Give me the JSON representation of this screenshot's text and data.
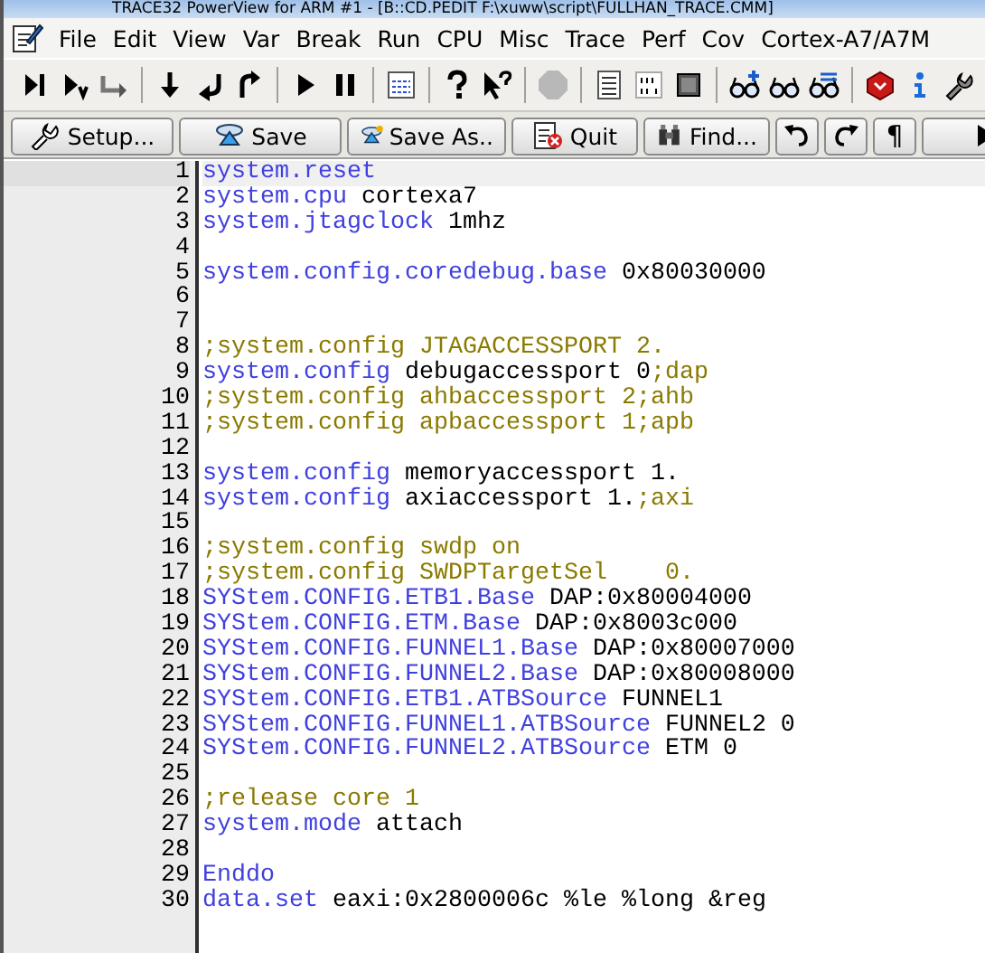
{
  "window": {
    "title": "TRACE32 PowerView for ARM #1 - [B::CD.PEDIT F:\\xuww\\script\\FULLHAN_TRACE.CMM]"
  },
  "menu": [
    "File",
    "Edit",
    "View",
    "Var",
    "Break",
    "Run",
    "CPU",
    "Misc",
    "Trace",
    "Perf",
    "Cov",
    "Cortex-A7/A7M"
  ],
  "toolbar": [
    {
      "kind": "step"
    },
    {
      "kind": "step-over"
    },
    {
      "kind": "step-out"
    },
    {
      "kind": "sep"
    },
    {
      "kind": "down"
    },
    {
      "kind": "return"
    },
    {
      "kind": "redo"
    },
    {
      "kind": "sep"
    },
    {
      "kind": "go"
    },
    {
      "kind": "pause"
    },
    {
      "kind": "sep"
    },
    {
      "kind": "note"
    },
    {
      "kind": "sep"
    },
    {
      "kind": "help"
    },
    {
      "kind": "help-pointer"
    },
    {
      "kind": "sep"
    },
    {
      "kind": "stop",
      "disabled": true
    },
    {
      "kind": "sep"
    },
    {
      "kind": "list"
    },
    {
      "kind": "binary"
    },
    {
      "kind": "chip"
    },
    {
      "kind": "sep"
    },
    {
      "kind": "glasses-plus"
    },
    {
      "kind": "glasses"
    },
    {
      "kind": "glasses-list"
    },
    {
      "kind": "sep"
    },
    {
      "kind": "box"
    },
    {
      "kind": "info"
    },
    {
      "kind": "wrench"
    }
  ],
  "editor_buttons": [
    {
      "kind": "wrench",
      "label": "Setup..."
    },
    {
      "kind": "save",
      "label": "Save"
    },
    {
      "kind": "save-as",
      "label": "Save As.."
    },
    {
      "kind": "quit",
      "label": "Quit"
    },
    {
      "kind": "find",
      "label": "Find..."
    },
    {
      "kind": "undo"
    },
    {
      "kind": "redo"
    },
    {
      "kind": "text",
      "label": "¶"
    },
    {
      "kind": "more"
    }
  ],
  "lines": [
    {
      "number": "1",
      "selected": true,
      "segments": [
        {
          "kind": "keyword",
          "text": "system.reset"
        }
      ]
    },
    {
      "number": "2",
      "selected": false,
      "segments": [
        {
          "kind": "keyword",
          "text": "system.cpu"
        },
        {
          "kind": "plain",
          "text": " cortexa7"
        }
      ]
    },
    {
      "number": "3",
      "selected": false,
      "segments": [
        {
          "kind": "keyword",
          "text": "system.jtagclock"
        },
        {
          "kind": "plain",
          "text": " 1mhz"
        }
      ]
    },
    {
      "number": "4",
      "selected": false
    },
    {
      "number": "5",
      "selected": false,
      "segments": [
        {
          "kind": "keyword",
          "text": "system.config.coredebug.base"
        },
        {
          "kind": "plain",
          "text": " 0x80030000"
        }
      ]
    },
    {
      "number": "6",
      "selected": false
    },
    {
      "number": "7",
      "selected": false
    },
    {
      "number": "8",
      "selected": false,
      "segments": [
        {
          "kind": "comment",
          "text": ";system.config JTAGACCESSPORT 2."
        }
      ]
    },
    {
      "number": "9",
      "selected": false,
      "segments": [
        {
          "kind": "keyword",
          "text": "system.config"
        },
        {
          "kind": "plain",
          "text": " debugaccessport 0"
        },
        {
          "kind": "comment",
          "text": ";dap"
        }
      ]
    },
    {
      "number": "10",
      "selected": false,
      "segments": [
        {
          "kind": "comment",
          "text": ";system.config ahbaccessport 2;ahb"
        }
      ]
    },
    {
      "number": "11",
      "selected": false,
      "segments": [
        {
          "kind": "comment",
          "text": ";system.config apbaccessport 1;apb"
        }
      ]
    },
    {
      "number": "12",
      "selected": false
    },
    {
      "number": "13",
      "selected": false,
      "segments": [
        {
          "kind": "keyword",
          "text": "system.config"
        },
        {
          "kind": "plain",
          "text": " memoryaccessport 1."
        }
      ]
    },
    {
      "number": "14",
      "selected": false,
      "segments": [
        {
          "kind": "keyword",
          "text": "system.config"
        },
        {
          "kind": "plain",
          "text": " axiaccessport 1."
        },
        {
          "kind": "comment",
          "text": ";axi"
        }
      ]
    },
    {
      "number": "15",
      "selected": false
    },
    {
      "number": "16",
      "selected": false,
      "segments": [
        {
          "kind": "comment",
          "text": ";system.config swdp on"
        }
      ]
    },
    {
      "number": "17",
      "selected": false,
      "segments": [
        {
          "kind": "comment",
          "text": ";system.config SWDPTargetSel    0."
        }
      ]
    },
    {
      "number": "18",
      "selected": false,
      "segments": [
        {
          "kind": "keyword",
          "text": "SYStem.CONFIG.ETB1.Base"
        },
        {
          "kind": "plain",
          "text": " DAP:0x80004000"
        }
      ]
    },
    {
      "number": "19",
      "selected": false,
      "segments": [
        {
          "kind": "keyword",
          "text": "SYStem.CONFIG.ETM.Base"
        },
        {
          "kind": "plain",
          "text": " DAP:0x8003c000"
        }
      ]
    },
    {
      "number": "20",
      "selected": false,
      "segments": [
        {
          "kind": "keyword",
          "text": "SYStem.CONFIG.FUNNEL1.Base"
        },
        {
          "kind": "plain",
          "text": " DAP:0x80007000"
        }
      ]
    },
    {
      "number": "21",
      "selected": false,
      "segments": [
        {
          "kind": "keyword",
          "text": "SYStem.CONFIG.FUNNEL2.Base"
        },
        {
          "kind": "plain",
          "text": " DAP:0x80008000"
        }
      ]
    },
    {
      "number": "22",
      "selected": false,
      "segments": [
        {
          "kind": "keyword",
          "text": "SYStem.CONFIG.ETB1.ATBSource"
        },
        {
          "kind": "plain",
          "text": " FUNNEL1"
        }
      ]
    },
    {
      "number": "23",
      "selected": false,
      "segments": [
        {
          "kind": "keyword",
          "text": "SYStem.CONFIG.FUNNEL1.ATBSource"
        },
        {
          "kind": "plain",
          "text": " FUNNEL2 0"
        }
      ]
    },
    {
      "number": "24",
      "selected": false,
      "segments": [
        {
          "kind": "keyword",
          "text": "SYStem.CONFIG.FUNNEL2.ATBSource"
        },
        {
          "kind": "plain",
          "text": " ETM 0"
        }
      ]
    },
    {
      "number": "25",
      "selected": false
    },
    {
      "number": "26",
      "selected": false,
      "segments": [
        {
          "kind": "comment",
          "text": ";release core 1"
        }
      ]
    },
    {
      "number": "27",
      "selected": false,
      "segments": [
        {
          "kind": "keyword",
          "text": "system.mode"
        },
        {
          "kind": "plain",
          "text": " attach"
        }
      ]
    },
    {
      "number": "28",
      "selected": false
    },
    {
      "number": "29",
      "selected": false,
      "segments": [
        {
          "kind": "keyword",
          "text": "Enddo"
        }
      ]
    },
    {
      "number": "30",
      "selected": false,
      "segments": [
        {
          "kind": "keyword",
          "text": "data.set"
        },
        {
          "kind": "plain",
          "text": " eaxi:0x2800006c %le %long &reg"
        }
      ]
    }
  ]
}
